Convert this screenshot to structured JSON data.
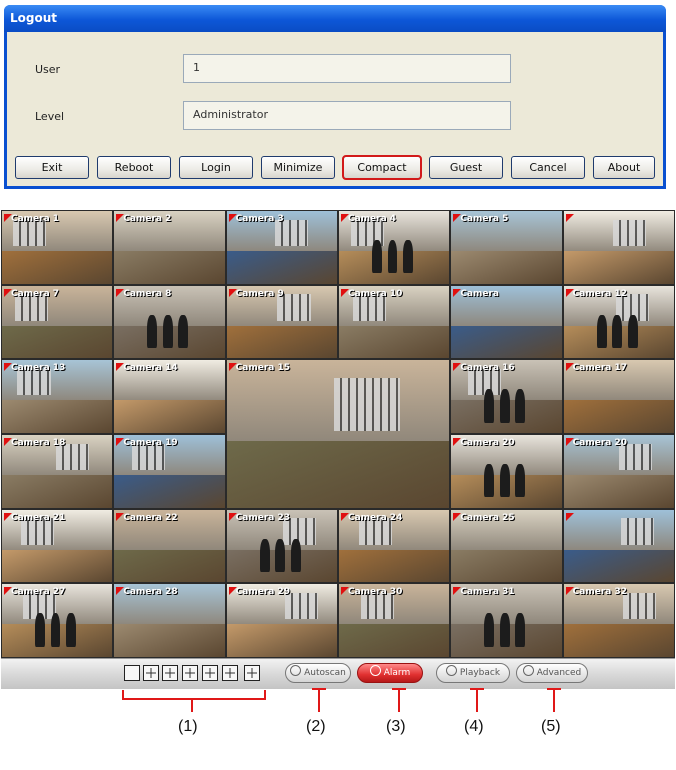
{
  "dialog": {
    "title": "Logout",
    "user_label": "User",
    "user_value": "1",
    "level_label": "Level",
    "level_value": "Administrator",
    "buttons": [
      "Exit",
      "Reboot",
      "Login",
      "Minimize",
      "Compact",
      "Guest",
      "Cancel",
      "About"
    ],
    "highlighted_button": "Compact"
  },
  "cameras": [
    {
      "label": "Camera 1"
    },
    {
      "label": "Camera 2"
    },
    {
      "label": "Camera 3"
    },
    {
      "label": "Camera 4"
    },
    {
      "label": "Camera 5"
    },
    {
      "label": ""
    },
    {
      "label": "Camera 7"
    },
    {
      "label": "Camera 8"
    },
    {
      "label": "Camera 9"
    },
    {
      "label": "Camera 10"
    },
    {
      "label": "Camera"
    },
    {
      "label": "Camera 12"
    },
    {
      "label": "Camera 13"
    },
    {
      "label": "Camera 14"
    },
    {
      "label": "Camera 15"
    },
    {
      "label": "Camera 16"
    },
    {
      "label": "Camera 17"
    },
    {
      "label": "Camera 18"
    },
    {
      "label": "Camera 19"
    },
    {
      "label": "Camera 20"
    },
    {
      "label": "Camera 20"
    },
    {
      "label": "Camera 21"
    },
    {
      "label": "Camera 22"
    },
    {
      "label": "Camera 23"
    },
    {
      "label": "Camera 24"
    },
    {
      "label": "Camera 25"
    },
    {
      "label": ""
    },
    {
      "label": "Camera 27"
    },
    {
      "label": "Camera 28"
    },
    {
      "label": "Camera 29"
    },
    {
      "label": "Camera 30"
    },
    {
      "label": "Camera 31"
    },
    {
      "label": "Camera 32"
    }
  ],
  "toolbar": {
    "layout_icons": [
      "single-view-icon",
      "quad-view-icon",
      "nine-view-icon",
      "sixteen-view-icon",
      "thirteen-view-icon",
      "twentyfive-view-icon",
      "thirtythree-view-icon"
    ],
    "buttons": [
      "Autoscan",
      "Alarm",
      "Playback",
      "Advanced"
    ]
  },
  "callouts": [
    "(1)",
    "(2)",
    "(3)",
    "(4)",
    "(5)"
  ],
  "colors": {
    "title_bar": "#0d57d8",
    "dialog_bg": "#ece9d8",
    "highlight": "#d21a1a",
    "alarm": "#e03030"
  }
}
